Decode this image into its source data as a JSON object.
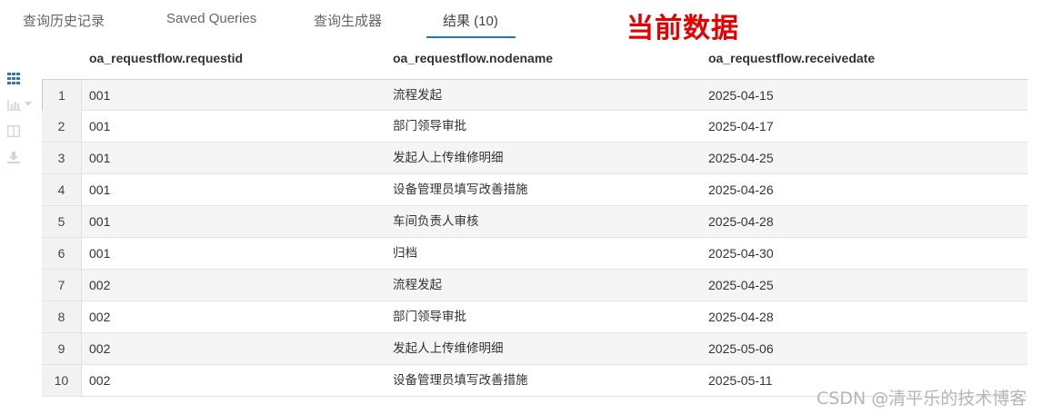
{
  "tabs": [
    {
      "label": "查询历史记录"
    },
    {
      "label": "Saved Queries"
    },
    {
      "label": "查询生成器"
    },
    {
      "label": "结果 (10)",
      "active": true
    }
  ],
  "annotation": "当前数据",
  "toolbar": {
    "icons": [
      "grid-view-icon",
      "chart-icon",
      "chevron-down-icon",
      "columns-icon",
      "download-icon"
    ],
    "accent_color": "#2a7ab0",
    "muted_color": "#cfd6dc"
  },
  "results": {
    "columns": [
      "oa_requestflow.requestid",
      "oa_requestflow.nodename",
      "oa_requestflow.receivedate"
    ],
    "rows": [
      {
        "num": "1",
        "requestid": "001",
        "nodename": "流程发起",
        "receivedate": "2025-04-15"
      },
      {
        "num": "2",
        "requestid": "001",
        "nodename": "部门领导审批",
        "receivedate": "2025-04-17"
      },
      {
        "num": "3",
        "requestid": "001",
        "nodename": "发起人上传维修明细",
        "receivedate": "2025-04-25"
      },
      {
        "num": "4",
        "requestid": "001",
        "nodename": "设备管理员填写改善措施",
        "receivedate": "2025-04-26"
      },
      {
        "num": "5",
        "requestid": "001",
        "nodename": "车间负责人审核",
        "receivedate": "2025-04-28"
      },
      {
        "num": "6",
        "requestid": "001",
        "nodename": "归档",
        "receivedate": "2025-04-30"
      },
      {
        "num": "7",
        "requestid": "002",
        "nodename": "流程发起",
        "receivedate": "2025-04-25"
      },
      {
        "num": "8",
        "requestid": "002",
        "nodename": "部门领导审批",
        "receivedate": "2025-04-28"
      },
      {
        "num": "9",
        "requestid": "002",
        "nodename": "发起人上传维修明细",
        "receivedate": "2025-05-06"
      },
      {
        "num": "10",
        "requestid": "002",
        "nodename": "设备管理员填写改善措施",
        "receivedate": "2025-05-11"
      }
    ]
  },
  "watermark": "CSDN @清平乐的技术博客"
}
